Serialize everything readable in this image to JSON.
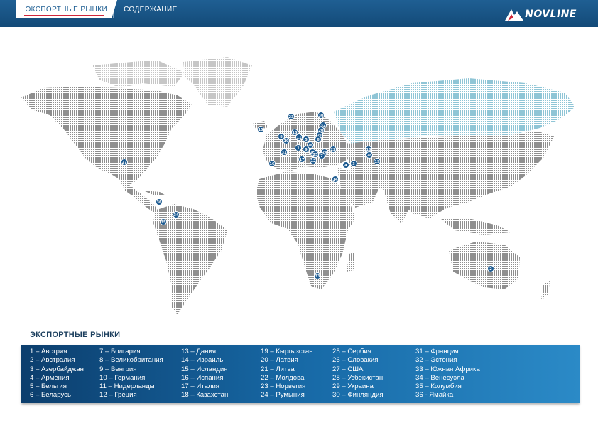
{
  "header": {
    "tabs": [
      {
        "label": "ЭКСПОРТНЫЕ РЫНКИ",
        "active": true
      },
      {
        "label": "СОДЕРЖАНИЕ",
        "active": false
      }
    ],
    "logo_text": "NOVLINE"
  },
  "colors": {
    "header_blue": "#134a78",
    "accent_red": "#d0263a",
    "marker_blue": "#1c5a90",
    "russia_highlight": "#a9d3de",
    "map_dots": "#8f8f8f"
  },
  "section_title": "ЭКСПОРТНЫЕ РЫНКИ",
  "markets": [
    "1 – Австрия",
    "2 – Австралия",
    "3 – Азербайджан",
    "4 – Армения",
    "5 – Бельгия",
    "6 – Беларусь",
    "7 – Болгария",
    "8 – Великобритания",
    "9 – Венгрия",
    "10 – Германия",
    "11 – Нидерланды",
    "12 – Греция",
    "13 – Дания",
    "14 – Израиль",
    "15 – Исландия",
    "16 – Испания",
    "17 – Италия",
    "18 – Казахстан",
    "19 – Кыргызстан",
    "20 – Латвия",
    "21 – Литва",
    "22 – Молдова",
    "23 – Норвегия",
    "24 – Румыния",
    "25 – Сербия",
    "26 – Словакия",
    "27 – США",
    "28 – Узбекистан",
    "29 – Украина",
    "30 – Финляндия",
    "31 – Франция",
    "32 – Эстония",
    "33 – Южная Африка",
    "34 – Венесуэла",
    "35 – Колумбия",
    "36 - Ямайка"
  ],
  "map_markers": [
    {
      "n": "15"
    },
    {
      "n": "23"
    },
    {
      "n": "30"
    },
    {
      "n": "32"
    },
    {
      "n": "20"
    },
    {
      "n": "21"
    },
    {
      "n": "8"
    },
    {
      "n": "13"
    },
    {
      "n": "11"
    },
    {
      "n": "5"
    },
    {
      "n": "10"
    },
    {
      "n": "6"
    },
    {
      "n": "26"
    },
    {
      "n": "1"
    },
    {
      "n": "9"
    },
    {
      "n": "29"
    },
    {
      "n": "31"
    },
    {
      "n": "17"
    },
    {
      "n": "25"
    },
    {
      "n": "24"
    },
    {
      "n": "22"
    },
    {
      "n": "7"
    },
    {
      "n": "12"
    },
    {
      "n": "16"
    },
    {
      "n": "18"
    },
    {
      "n": "19"
    },
    {
      "n": "28"
    },
    {
      "n": "3"
    },
    {
      "n": "4"
    },
    {
      "n": "14"
    },
    {
      "n": "27"
    },
    {
      "n": "36"
    },
    {
      "n": "34"
    },
    {
      "n": "35"
    },
    {
      "n": "33"
    },
    {
      "n": "2"
    }
  ]
}
